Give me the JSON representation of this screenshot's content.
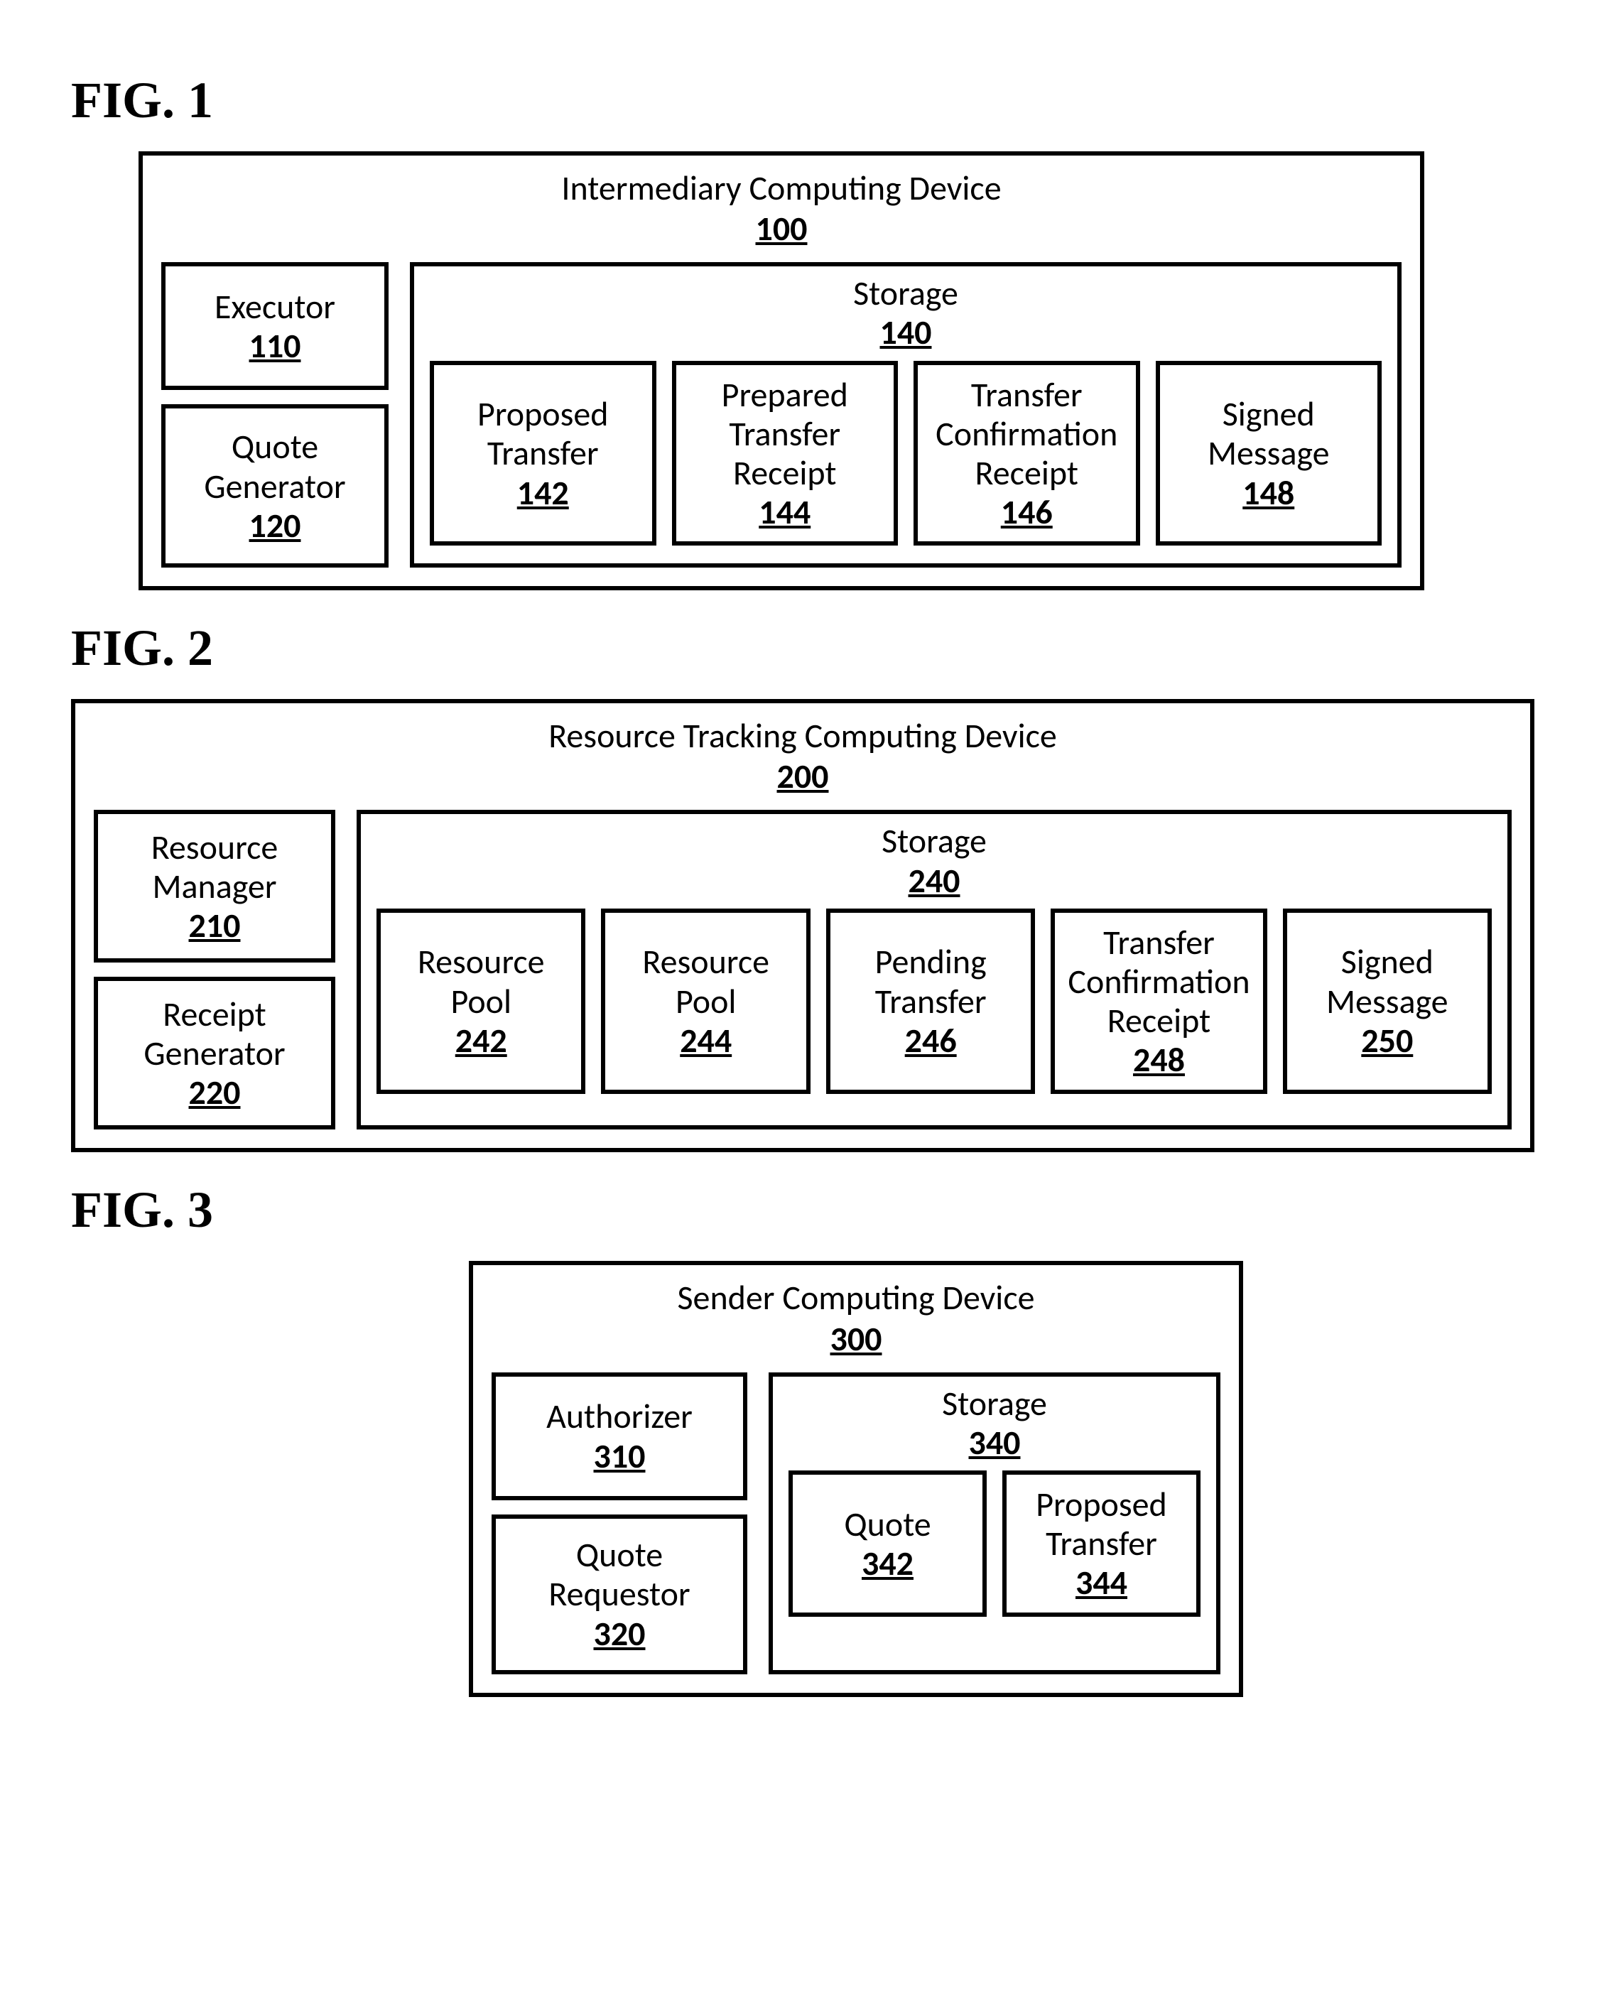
{
  "fig1": {
    "label": "FIG. 1",
    "outer": {
      "title": "Intermediary Computing Device",
      "ref": "100"
    },
    "left": [
      {
        "title": "Executor",
        "ref": "110"
      },
      {
        "title": "Quote Generator",
        "ref": "120"
      }
    ],
    "storage": {
      "title": "Storage",
      "ref": "140",
      "items": [
        {
          "title": "Proposed Transfer",
          "ref": "142"
        },
        {
          "title": "Prepared Transfer Receipt",
          "ref": "144"
        },
        {
          "title": "Transfer Confirmation Receipt",
          "ref": "146"
        },
        {
          "title": "Signed Message",
          "ref": "148"
        }
      ]
    }
  },
  "fig2": {
    "label": "FIG. 2",
    "outer": {
      "title": "Resource Tracking Computing Device",
      "ref": "200"
    },
    "left": [
      {
        "title": "Resource Manager",
        "ref": "210"
      },
      {
        "title": "Receipt Generator",
        "ref": "220"
      }
    ],
    "storage": {
      "title": "Storage",
      "ref": "240",
      "items": [
        {
          "title": "Resource Pool",
          "ref": "242"
        },
        {
          "title": "Resource Pool",
          "ref": "244"
        },
        {
          "title": "Pending Transfer",
          "ref": "246"
        },
        {
          "title": "Transfer Confirmation Receipt",
          "ref": "248"
        },
        {
          "title": "Signed Message",
          "ref": "250"
        }
      ]
    }
  },
  "fig3": {
    "label": "FIG. 3",
    "outer": {
      "title": "Sender Computing Device",
      "ref": "300"
    },
    "left": [
      {
        "title": "Authorizer",
        "ref": "310"
      },
      {
        "title": "Quote Requestor",
        "ref": "320"
      }
    ],
    "storage": {
      "title": "Storage",
      "ref": "340",
      "items": [
        {
          "title": "Quote",
          "ref": "342"
        },
        {
          "title": "Proposed Transfer",
          "ref": "344"
        }
      ]
    }
  }
}
